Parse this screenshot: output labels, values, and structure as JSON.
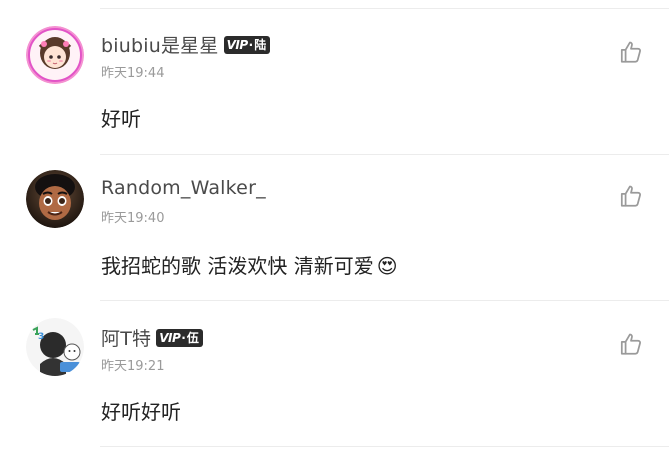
{
  "comments": [
    {
      "username": "biubiu是星星",
      "badge": {
        "vip": "VIP",
        "level": "陆"
      },
      "time": "昨天19:44",
      "text": "好听",
      "avatar_icon": "girl-avatar-icon"
    },
    {
      "username": "Random_Walker_",
      "badge": null,
      "time": "昨天19:40",
      "text": "我招蛇的歌 活泼欢快 清新可爱",
      "emoji": "😍",
      "avatar_icon": "boy-character-avatar-icon"
    },
    {
      "username": "阿T特",
      "badge": {
        "vip": "VIP",
        "level": "伍"
      },
      "time": "昨天19:21",
      "text": "好听好听",
      "avatar_icon": "cartoon-avatar-icon"
    }
  ],
  "colors": {
    "username": "#4a4a4a",
    "time": "#9a9a9a",
    "content": "#222222",
    "badge_bg": "#2b2b2b",
    "divider": "#ececec",
    "like_icon": "#9a9a9a"
  },
  "like_icon": "thumbs-up-icon"
}
